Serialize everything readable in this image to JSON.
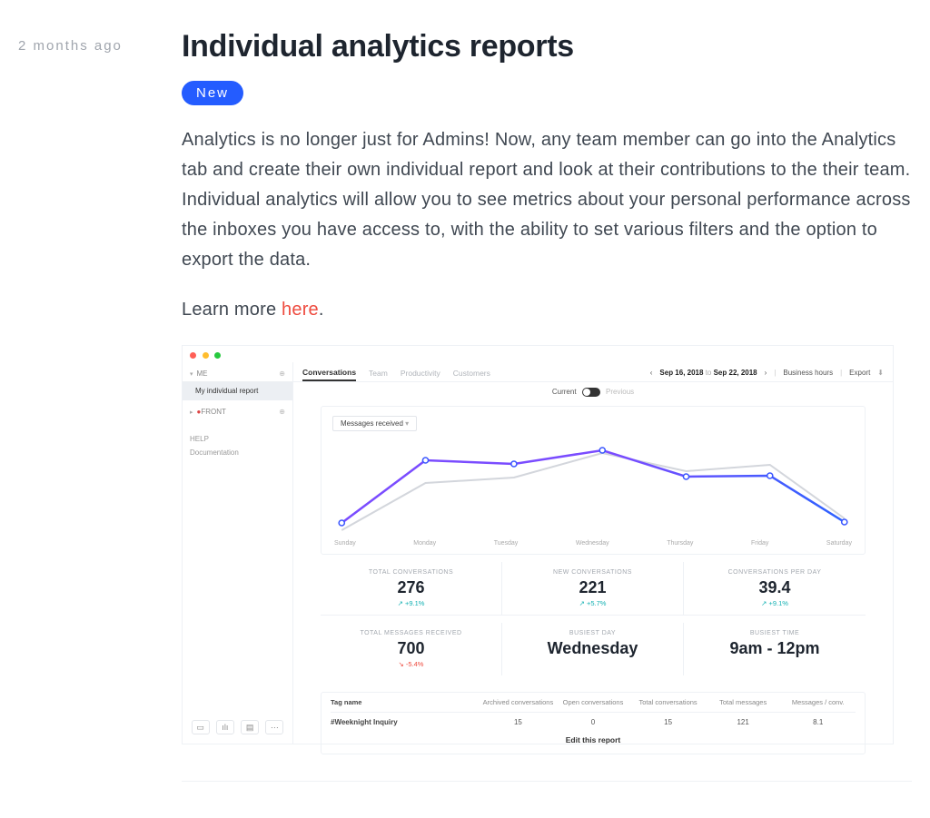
{
  "meta": {
    "time_ago": "2 months ago"
  },
  "post": {
    "title": "Individual analytics reports",
    "badge": "New",
    "paragraph_1": "Analytics is no longer just for Admins! Now, any team member can go into the Analytics tab and create their own individual report and look at their contributions to the their team. Individual analytics will allow you to see metrics about your personal performance across the inboxes you have access to, with the ability to set various filters and the option to export the data.",
    "learn_prefix": "Learn more ",
    "learn_link": "here",
    "learn_suffix": "."
  },
  "shot": {
    "sidebar": {
      "me": "ME",
      "my_report": "My individual report",
      "front": "FRONT",
      "help": "HELP",
      "docs": "Documentation"
    },
    "tabs": {
      "conversations": "Conversations",
      "team": "Team",
      "productivity": "Productivity",
      "customers": "Customers"
    },
    "topbar": {
      "date_from": "Sep 16, 2018",
      "date_to_word": "to",
      "date_to": "Sep 22, 2018",
      "business_hours": "Business hours",
      "export": "Export"
    },
    "filter": {
      "current": "Current",
      "previous": "Previous"
    },
    "chart_selector": "Messages received",
    "metrics": {
      "m1": {
        "label": "TOTAL CONVERSATIONS",
        "value": "276",
        "delta": "↗ +9.1%"
      },
      "m2": {
        "label": "NEW CONVERSATIONS",
        "value": "221",
        "delta": "↗ +5.7%"
      },
      "m3": {
        "label": "CONVERSATIONS PER DAY",
        "value": "39.4",
        "delta": "↗ +9.1%"
      },
      "m4": {
        "label": "TOTAL MESSAGES RECEIVED",
        "value": "700",
        "delta": "↘ -5.4%"
      },
      "m5": {
        "label": "BUSIEST DAY",
        "value": "Wednesday"
      },
      "m6": {
        "label": "BUSIEST TIME",
        "value": "9am - 12pm"
      }
    },
    "table": {
      "h_tag": "Tag name",
      "h_archived": "Archived conversations",
      "h_open": "Open conversations",
      "h_total": "Total conversations",
      "h_msgs": "Total messages",
      "h_per": "Messages / conv.",
      "r_tag": "#Weeknight Inquiry",
      "r_archived": "15",
      "r_open": "0",
      "r_total": "15",
      "r_msgs": "121",
      "r_per": "8.1",
      "edit": "Edit this report"
    }
  },
  "chart_data": {
    "type": "line",
    "title": "Messages received",
    "xlabel": "",
    "ylabel": "",
    "categories": [
      "Sunday",
      "Monday",
      "Tuesday",
      "Wednesday",
      "Thursday",
      "Friday",
      "Saturday"
    ],
    "series": [
      {
        "name": "Current",
        "values": [
          20,
          105,
          100,
          118,
          80,
          82,
          22
        ]
      },
      {
        "name": "Previous",
        "values": [
          10,
          72,
          80,
          115,
          88,
          98,
          28
        ]
      }
    ],
    "ylim": [
      0,
      130
    ]
  }
}
